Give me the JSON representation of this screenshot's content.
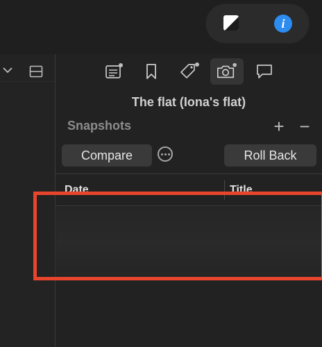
{
  "toolbar": {
    "icons": [
      "contrast-icon",
      "info-icon"
    ],
    "info_glyph": "i"
  },
  "inspector": {
    "tabs": [
      {
        "name": "document-tab",
        "icon": "document-icon"
      },
      {
        "name": "bookmarks-tab",
        "icon": "bookmark-icon"
      },
      {
        "name": "tags-tab",
        "icon": "tag-icon"
      },
      {
        "name": "snapshots-tab",
        "icon": "camera-icon",
        "selected": true
      },
      {
        "name": "comments-tab",
        "icon": "comment-icon"
      }
    ],
    "document_title": "The flat (Iona's flat)",
    "section_title": "Snapshots",
    "add_label": "+",
    "remove_label": "−",
    "compare_label": "Compare",
    "rollback_label": "Roll Back",
    "table": {
      "columns": [
        "Date",
        "Title"
      ],
      "rows": []
    }
  },
  "colors": {
    "highlight": "#e8452c",
    "info_accent": "#2d8cf0",
    "background": "#222222"
  }
}
